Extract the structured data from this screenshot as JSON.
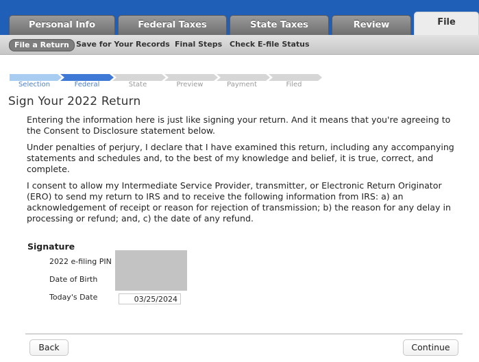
{
  "main_tabs": [
    {
      "label": "Personal Info"
    },
    {
      "label": "Federal Taxes"
    },
    {
      "label": "State Taxes"
    },
    {
      "label": "Review"
    },
    {
      "label": "File"
    }
  ],
  "sub_nav": [
    {
      "label": "File a Return"
    },
    {
      "label": "Save for Your Records"
    },
    {
      "label": "Final Steps"
    },
    {
      "label": "Check E-file Status"
    }
  ],
  "progress": {
    "steps": [
      {
        "label": "Selection"
      },
      {
        "label": "Federal"
      },
      {
        "label": "State"
      },
      {
        "label": "Preview"
      },
      {
        "label": "Payment"
      },
      {
        "label": "Filed"
      }
    ],
    "current_step": "Federal",
    "colors": {
      "done": "#a9cdf0",
      "current": "#3f79d6",
      "pending": "#d6d6d6"
    }
  },
  "page": {
    "title": "Sign Your 2022 Return",
    "paragraphs": [
      "Entering the information here is just like signing your return. And it means that you're agreeing to the Consent to Disclosure statement below.",
      "Under penalties of perjury, I declare that I have examined this return, including any accompanying statements and schedules and, to the best of my knowledge and belief, it is true, correct, and complete.",
      "I consent to allow my Intermediate Service Provider, transmitter, or Electronic Return Originator (ERO) to send my return to IRS and to receive the following information from IRS: a) an acknowledgement of receipt or reason for rejection of transmission; b) the reason for any delay in processing or refund; and, c) the date of any refund."
    ]
  },
  "signature": {
    "heading": "Signature",
    "pin_label": "2022 e-filing PIN",
    "dob_label": "Date of Birth",
    "today_label": "Today's Date",
    "today_value": "03/25/2024"
  },
  "footer": {
    "back_label": "Back",
    "continue_label": "Continue"
  }
}
